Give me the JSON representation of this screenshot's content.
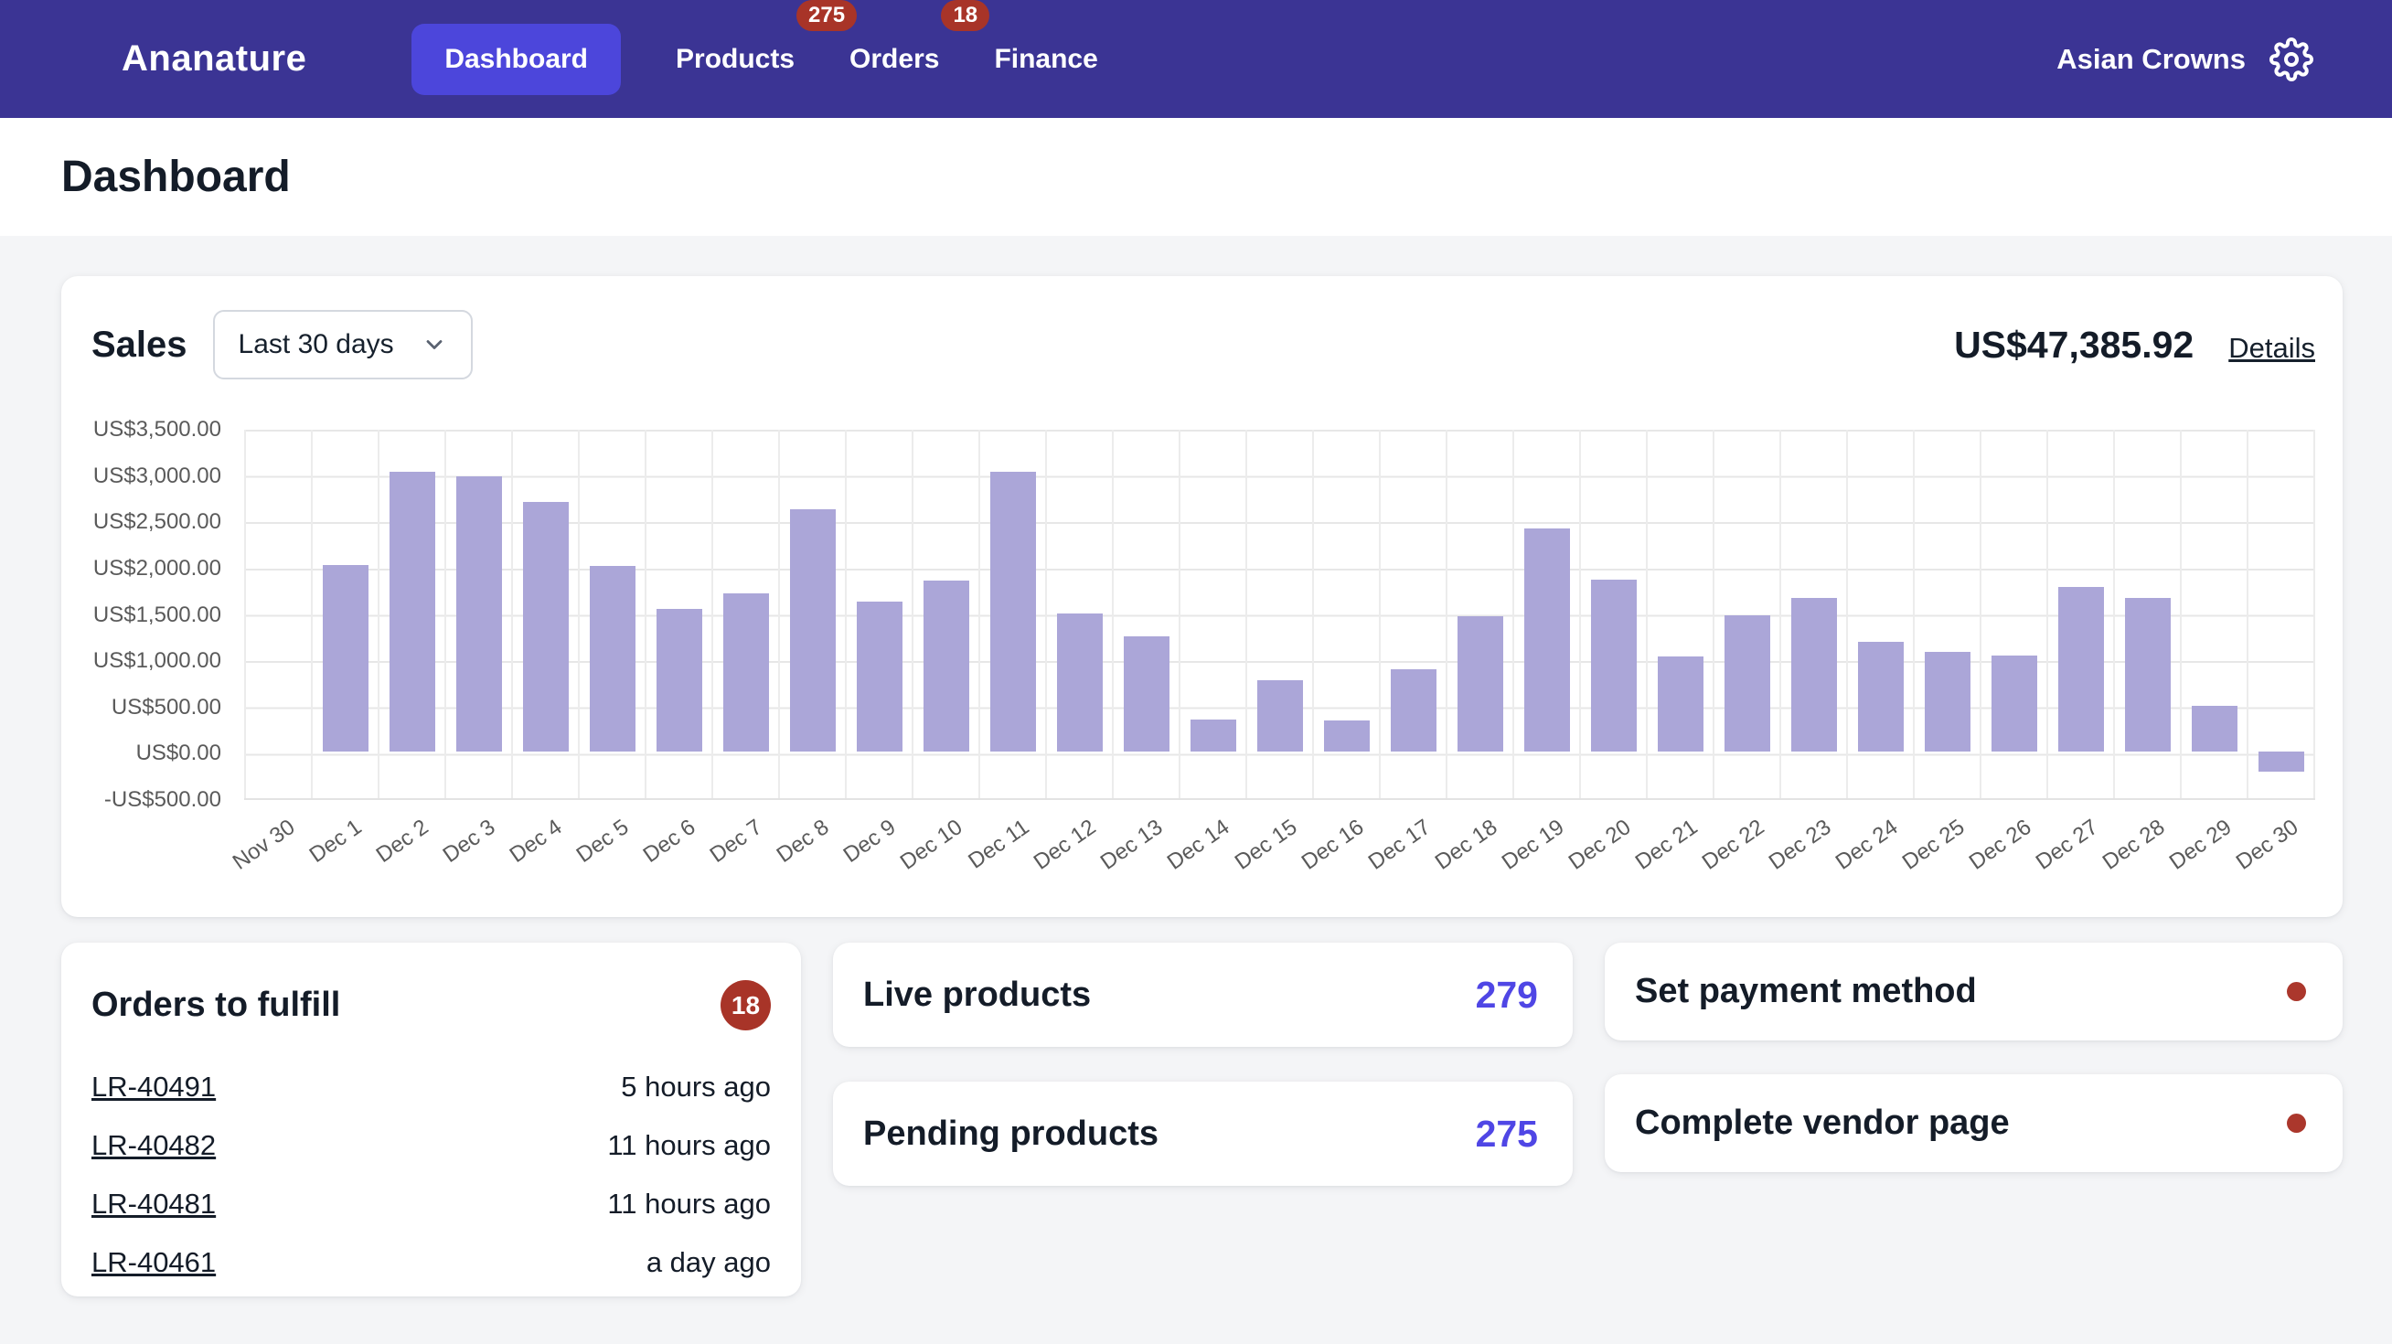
{
  "nav": {
    "brand": "Ananature",
    "items": [
      {
        "label": "Dashboard",
        "active": true
      },
      {
        "label": "Products",
        "badge": "275"
      },
      {
        "label": "Orders",
        "badge": "18"
      },
      {
        "label": "Finance"
      }
    ],
    "account": "Asian Crowns",
    "settings_icon": "gear-icon"
  },
  "page": {
    "title": "Dashboard"
  },
  "sales": {
    "title": "Sales",
    "range_selected": "Last 30 days",
    "total": "US$47,385.92",
    "details_label": "Details"
  },
  "chart_data": {
    "type": "bar",
    "title": "Sales last 30 days",
    "categories": [
      "Nov 30",
      "Dec 1",
      "Dec 2",
      "Dec 3",
      "Dec 4",
      "Dec 5",
      "Dec 6",
      "Dec 7",
      "Dec 8",
      "Dec 9",
      "Dec 10",
      "Dec 11",
      "Dec 12",
      "Dec 13",
      "Dec 14",
      "Dec 15",
      "Dec 16",
      "Dec 17",
      "Dec 18",
      "Dec 19",
      "Dec 20",
      "Dec 21",
      "Dec 22",
      "Dec 23",
      "Dec 24",
      "Dec 25",
      "Dec 26",
      "Dec 27",
      "Dec 28",
      "Dec 29",
      "Dec 30"
    ],
    "values": [
      0,
      2020,
      3030,
      2980,
      2700,
      2010,
      1540,
      1715,
      2620,
      1625,
      1855,
      3030,
      1500,
      1245,
      350,
      770,
      335,
      890,
      1470,
      2415,
      1860,
      1035,
      1475,
      1660,
      1185,
      1085,
      1040,
      1785,
      1660,
      500,
      -215
    ],
    "y_tick_labels": [
      "US$3,500.00",
      "US$3,000.00",
      "US$2,500.00",
      "US$2,000.00",
      "US$1,500.00",
      "US$1,000.00",
      "US$500.00",
      "US$0.00",
      "-US$500.00"
    ],
    "ylim": [
      -500,
      3500
    ],
    "y_step": 500,
    "grid": true,
    "legend": "none",
    "bar_color": "#aba6d8",
    "x_label_rotation": -35
  },
  "orders": {
    "title": "Orders to fulfill",
    "badge": "18",
    "rows": [
      {
        "id": "LR-40491",
        "time": "5 hours ago"
      },
      {
        "id": "LR-40482",
        "time": "11 hours ago"
      },
      {
        "id": "LR-40481",
        "time": "11 hours ago"
      },
      {
        "id": "LR-40461",
        "time": "a day ago"
      }
    ]
  },
  "stats": [
    {
      "label": "Live products",
      "value": "279"
    },
    {
      "label": "Pending products",
      "value": "275"
    }
  ],
  "tasks": [
    {
      "label": "Set payment method"
    },
    {
      "label": "Complete vendor page"
    }
  ],
  "colors": {
    "nav_bg": "#3b3494",
    "nav_active_bg": "#4c46db",
    "badge_red": "#a83428",
    "accent_indigo": "#4f46e5",
    "bar_purple": "#aba6d8",
    "page_bg": "#f4f5f7"
  }
}
